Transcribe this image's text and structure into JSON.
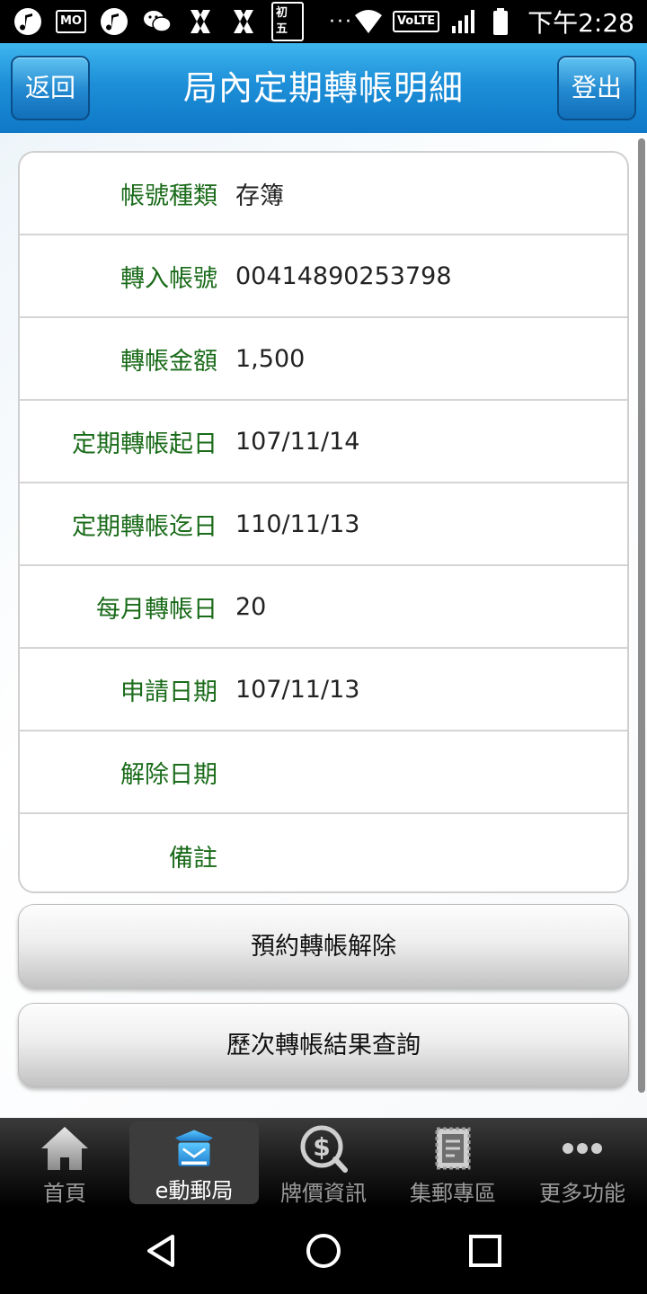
{
  "status_bar": {
    "badge_mo": "MO",
    "badge_lunar": "初五",
    "dots": "···",
    "volte": "VoLTE",
    "time": "下午2:28"
  },
  "header": {
    "title": "局內定期轉帳明細",
    "back_label": "返回",
    "logout_label": "登出"
  },
  "details": [
    {
      "label": "帳號種類",
      "value": "存簿"
    },
    {
      "label": "轉入帳號",
      "value": "00414890253798"
    },
    {
      "label": "轉帳金額",
      "value": "1,500"
    },
    {
      "label": "定期轉帳起日",
      "value": "107/11/14"
    },
    {
      "label": "定期轉帳迄日",
      "value": "110/11/13"
    },
    {
      "label": "每月轉帳日",
      "value": "20"
    },
    {
      "label": "申請日期",
      "value": "107/11/13"
    },
    {
      "label": "解除日期",
      "value": ""
    },
    {
      "label": "備註",
      "value": ""
    }
  ],
  "actions": {
    "cancel_reservation": "預約轉帳解除",
    "history_query": "歷次轉帳結果查詢"
  },
  "tabs": [
    {
      "label": "首頁",
      "icon": "home-icon"
    },
    {
      "label": "e動郵局",
      "icon": "post-office-icon"
    },
    {
      "label": "牌價資訊",
      "icon": "dollar-icon"
    },
    {
      "label": "集郵專區",
      "icon": "stamp-icon"
    },
    {
      "label": "更多功能",
      "icon": "more-icon"
    }
  ],
  "colors": {
    "header_blue": "#1d8fd8",
    "label_green": "#1a6b1a"
  }
}
